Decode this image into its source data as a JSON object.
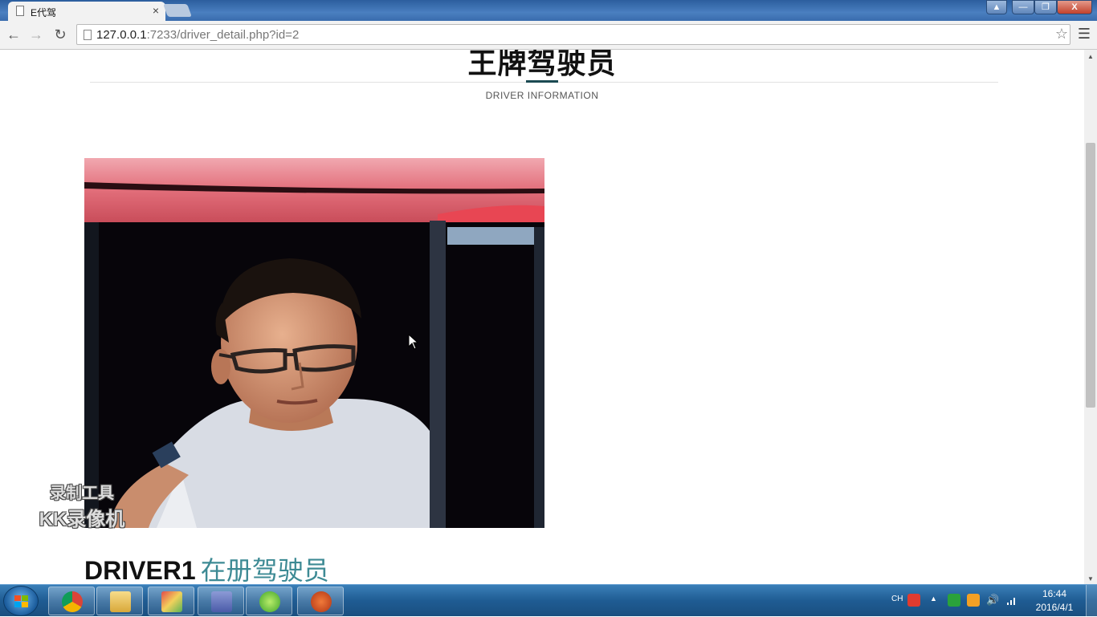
{
  "browser": {
    "tab_title": "E代驾",
    "url_host": "127.0.0.1",
    "url_rest": ":7233/driver_detail.php?id=2"
  },
  "page": {
    "title": "王牌驾驶员",
    "subtitle": "DRIVER INFORMATION",
    "driver_name": "DRIVER1",
    "driver_status": "在册驾驶员"
  },
  "watermark": {
    "line1": "录制工具",
    "line2": "KK录像机"
  },
  "taskbar": {
    "apps": [
      "chrome-icon",
      "file-explorer-icon",
      "paint-icon",
      "php-icon",
      "refresh-app-icon",
      "kk-recorder-icon"
    ],
    "tray_lang": "CH",
    "time": "16:44",
    "date": "2016/4/1"
  },
  "colors": {
    "accent": "#1b4a52",
    "status_text": "#3d8a94"
  }
}
